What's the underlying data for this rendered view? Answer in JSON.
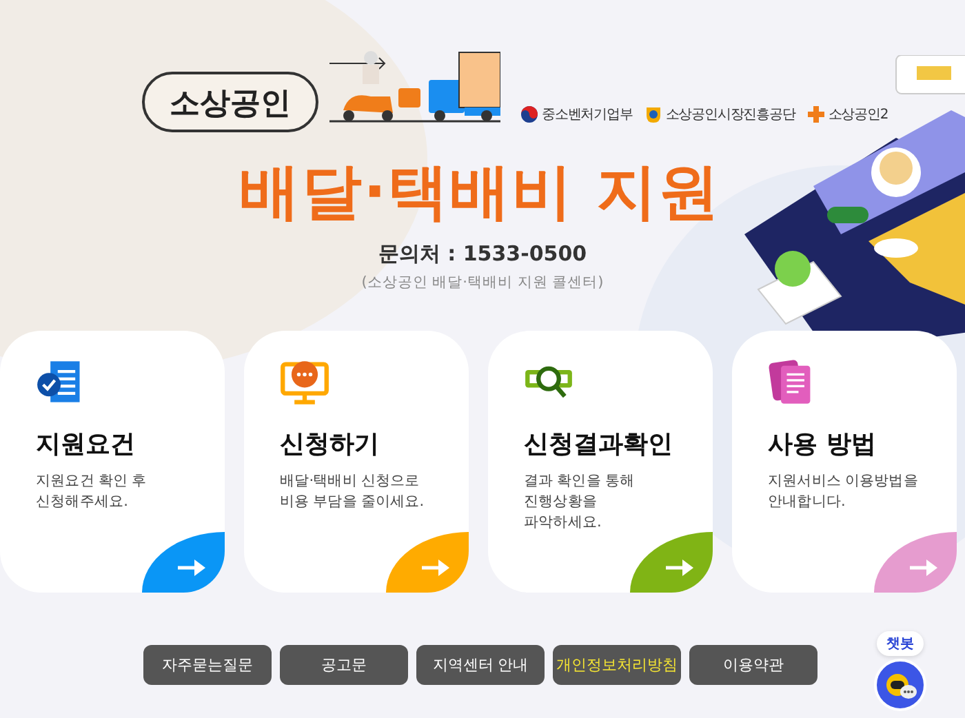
{
  "header": {
    "badge": "소상공인",
    "agencies": [
      {
        "name": "중소벤처기업부",
        "kind": "taegeuk"
      },
      {
        "name": "소상공인시장진흥공단",
        "kind": "shield"
      },
      {
        "name": "소상공인2",
        "kind": "plus"
      }
    ],
    "title": "배달·택배비 지원",
    "contact": "문의처 : 1533-0500",
    "contact_note": "(소상공인 배달·택배비 지원 콜센터)"
  },
  "cards": [
    {
      "title": "지원요건",
      "description": "지원요건 확인 후\n신청해주세요.",
      "color": "#0a96f6",
      "kind": "document"
    },
    {
      "title": "신청하기",
      "description": "배달·택배비 신청으로\n비용 부담을 줄이세요.",
      "color": "#ffab00",
      "kind": "monitor"
    },
    {
      "title": "신청결과확인",
      "description": "결과 확인을 통해\n진행상황을\n파악하세요.",
      "color": "#80b415",
      "kind": "search"
    },
    {
      "title": "사용 방법",
      "description": "지원서비스 이용방법을\n안내합니다.",
      "color": "#e69ccf",
      "kind": "pages"
    }
  ],
  "footer_links": [
    {
      "label": "자주묻는질문",
      "highlighted": false
    },
    {
      "label": "공고문",
      "highlighted": false
    },
    {
      "label": "지역센터 안내",
      "highlighted": false
    },
    {
      "label": "개인정보처리방침",
      "highlighted": true
    },
    {
      "label": "이용약관",
      "highlighted": false
    }
  ],
  "chatbot": {
    "label": "챗봇"
  }
}
